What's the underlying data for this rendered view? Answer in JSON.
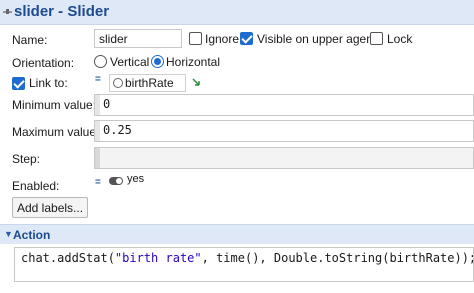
{
  "header": {
    "title": "slider - Slider",
    "icon": "slider-icon"
  },
  "name": {
    "label": "Name:",
    "value": "slider"
  },
  "flags": {
    "ignore": {
      "label": "Ignore",
      "checked": false
    },
    "visible_upper_agent": {
      "label": "Visible on upper agent",
      "checked": true
    },
    "lock": {
      "label": "Lock",
      "checked": false
    }
  },
  "orientation": {
    "label": "Orientation:",
    "options": [
      {
        "label": "Vertical",
        "selected": false
      },
      {
        "label": "Horizontal",
        "selected": true
      }
    ]
  },
  "link": {
    "label": "Link to:",
    "checked": true,
    "value": "birthRate"
  },
  "minimum": {
    "label": "Minimum value:",
    "value": "0"
  },
  "maximum": {
    "label": "Maximum value:",
    "value": "0.25"
  },
  "step": {
    "label": "Step:",
    "value": ""
  },
  "enabled": {
    "label": "Enabled:",
    "value": "yes"
  },
  "add_labels": {
    "label": "Add labels..."
  },
  "action": {
    "title": "Action",
    "code_prefix": "chat.addStat(",
    "code_string": "\"birth rate\"",
    "code_suffix": ", time(), Double.toString(birthRate));"
  },
  "colors": {
    "accent": "#1f6cd1",
    "header_bg": "#dfe8f6",
    "header_text": "#1d4b8f"
  }
}
